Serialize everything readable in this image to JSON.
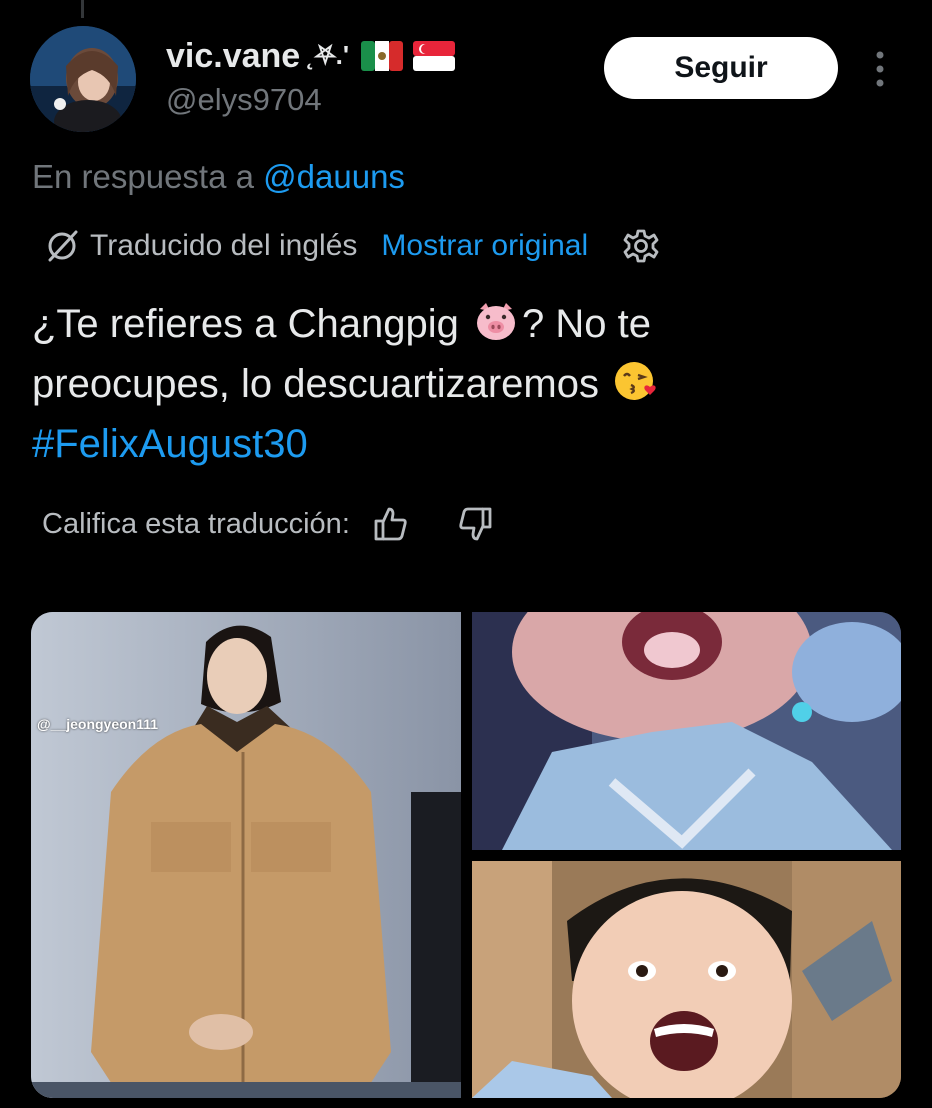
{
  "user": {
    "display_name": "vic.vane",
    "name_decoration": "˛⛧.'",
    "flags": [
      "mexico-flag",
      "singapore-flag"
    ],
    "handle": "@elys9704",
    "avatar": "profile-photo"
  },
  "header": {
    "follow_label": "Seguir",
    "more_icon": "more-vertical-icon"
  },
  "reply": {
    "prefix": "En respuesta a",
    "mention": "@dauuns"
  },
  "translation": {
    "icon": "translate-globe-icon",
    "label": "Traducido del inglés",
    "show_original": "Mostrar original",
    "settings_icon": "gear-icon"
  },
  "tweet": {
    "line1_text": "¿Te refieres a Changpig",
    "line1_emoji": "pig-face-emoji",
    "line1_after": "? No te",
    "line2_text": "preocupes, lo descuartizaremos",
    "line2_emoji": "kiss-emoji",
    "hashtag": "#FelixAugust30"
  },
  "rating": {
    "label": "Califica esta traducción:",
    "up_icon": "thumbs-up-icon",
    "down_icon": "thumbs-down-icon"
  },
  "media": [
    {
      "name": "photo-woman-jacket",
      "watermark": "@__jeongyeon111"
    },
    {
      "name": "photo-screaming-closeup"
    },
    {
      "name": "photo-screaming-man"
    }
  ],
  "colors": {
    "background": "#000000",
    "text": "#e7e9ea",
    "muted": "#71767b",
    "accent": "#1d9bf0"
  }
}
